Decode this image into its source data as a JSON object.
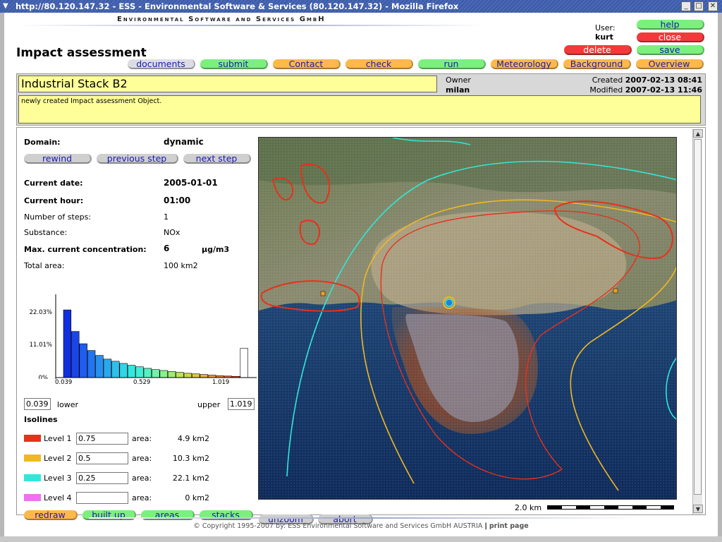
{
  "window": {
    "title": "http://80.120.147.32 - ESS - Environmental Software & Services (80.120.147.32) - Mozilla Firefox",
    "minimize_glyph": "_",
    "maximize_glyph": "□",
    "close_glyph": "✕"
  },
  "header": {
    "company": "Environmental Software and Services GmbH",
    "page_title": "Impact assessment",
    "user_label": "User:",
    "user_name": "kurt"
  },
  "top_buttons": {
    "help": "help",
    "close": "close",
    "delete": "delete",
    "save": "save"
  },
  "nav_buttons": {
    "documents": "documents",
    "submit": "submit",
    "contact": "Contact",
    "check": "check",
    "run": "run",
    "meteorology": "Meteorology",
    "background": "Background",
    "overview": "Overview"
  },
  "object": {
    "name": "Industrial Stack B2",
    "owner_label": "Owner",
    "owner_name": "milan",
    "created_label": "Created",
    "created_value": "2007-02-13 08:41",
    "modified_label": "Modified",
    "modified_value": "2007-02-13 11:46",
    "description": "newly created Impact assessment Object."
  },
  "panel": {
    "domain_label": "Domain:",
    "domain_value": "dynamic",
    "rewind": "rewind",
    "previous_step": "previous step",
    "next_step": "next step",
    "current_date_label": "Current date:",
    "current_date_value": "2005-01-01",
    "current_hour_label": "Current hour:",
    "current_hour_value": "01:00",
    "num_steps_label": "Number of steps:",
    "num_steps_value": "1",
    "substance_label": "Substance:",
    "substance_value": "NOx",
    "max_conc_label": "Max. current concentration:",
    "max_conc_value": "6",
    "max_conc_unit": "µg/m3",
    "total_area_label": "Total area:",
    "total_area_value": "100 km2",
    "lower_value": "0.039",
    "lower_label": "lower",
    "upper_label": "upper",
    "upper_value": "1.019",
    "isolines_label": "Isolines",
    "area_label": "area:",
    "levels": [
      {
        "label": "Level 1",
        "value": "0.75",
        "area": "4.9 km2",
        "color": "#e8301a"
      },
      {
        "label": "Level 2",
        "value": "0.5",
        "area": "10.3 km2",
        "color": "#f0b820"
      },
      {
        "label": "Level 3",
        "value": "0.25",
        "area": "22.1 km2",
        "color": "#30e8d8"
      },
      {
        "label": "Level 4",
        "value": "",
        "area": "0 km2",
        "color": "#f070f0"
      }
    ],
    "redraw": "redraw",
    "built_up": "built up",
    "areas": "areas",
    "stacks": "stacks"
  },
  "map": {
    "unzoom": "unzoom",
    "abort": "abort",
    "scale_label": "2.0 km"
  },
  "chart_data": {
    "type": "bar",
    "y_tick_labels": [
      "22.03%",
      "11.01%",
      "0%"
    ],
    "x_tick_labels": [
      "0.039",
      "0.529",
      "1.019"
    ],
    "ylim": [
      0,
      22.03
    ],
    "values": [
      22.0,
      15.0,
      11.0,
      8.8,
      7.2,
      6.0,
      5.3,
      4.6,
      4.0,
      3.5,
      3.0,
      2.6,
      2.3,
      2.0,
      1.7,
      1.4,
      1.2,
      1.0,
      0.8,
      0.6,
      0.5,
      0.4,
      9.5
    ],
    "colors": [
      "#1030e0",
      "#1a45ea",
      "#205cf0",
      "#2274f2",
      "#2690f0",
      "#2aa8ee",
      "#2ec0ea",
      "#30d6e6",
      "#34e6e0",
      "#40eed4",
      "#58f0c0",
      "#70f2a8",
      "#88f08c",
      "#a0ec70",
      "#b8e458",
      "#ccd848",
      "#dcc840",
      "#e8b43c",
      "#ee9c38",
      "#f08034",
      "#f06430",
      "#f04c2c",
      "#ffffff"
    ]
  },
  "footer": {
    "copyright": "© Copyright 1995-2007 by:   ESS   Environmental Software and Services GmbH AUSTRIA",
    "separator": "|",
    "print_page": "print page"
  }
}
